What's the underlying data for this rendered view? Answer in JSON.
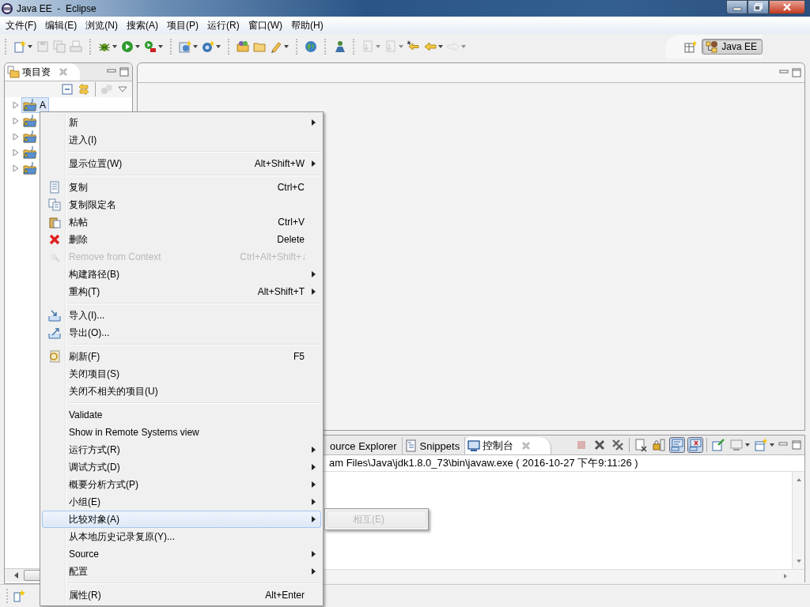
{
  "window": {
    "title": "Java EE  -  Eclipse"
  },
  "menu_bar": [
    "文件(F)",
    "编辑(E)",
    "浏览(N)",
    "搜索(A)",
    "项目(P)",
    "运行(R)",
    "窗口(W)",
    "帮助(H)"
  ],
  "toolbar": {
    "groups": [
      [
        {
          "disabled": false,
          "dropdown": true
        },
        {
          "disabled": true,
          "dropdown": false
        },
        {
          "disabled": true,
          "dropdown": false
        },
        {
          "disabled": true,
          "dropdown": false
        }
      ],
      [
        {
          "disabled": false,
          "dropdown": true
        },
        {
          "disabled": false,
          "dropdown": true
        },
        {
          "disabled": false,
          "dropdown": true
        }
      ],
      [
        {
          "disabled": false,
          "dropdown": true
        },
        {
          "disabled": false,
          "dropdown": true
        }
      ],
      [
        {
          "disabled": false,
          "dropdown": false
        },
        {
          "disabled": false,
          "dropdown": false
        },
        {
          "disabled": false,
          "dropdown": true
        }
      ],
      [
        {
          "disabled": false,
          "dropdown": false
        }
      ],
      [
        {
          "disabled": false,
          "dropdown": false
        }
      ],
      [
        {
          "disabled": true,
          "dropdown": true
        },
        {
          "disabled": true,
          "dropdown": true
        },
        {
          "disabled": false,
          "dropdown": false
        },
        {
          "disabled": false,
          "dropdown": true
        },
        {
          "disabled": true,
          "dropdown": true
        }
      ]
    ]
  },
  "perspective": {
    "label": "Java EE",
    "selected": true
  },
  "project_explorer": {
    "tab": {
      "label": "项目资"
    },
    "tree": [
      {
        "label": "A",
        "selected": true
      },
      {
        "selected": false
      },
      {
        "selected": false
      },
      {
        "selected": false
      },
      {
        "selected": false
      }
    ]
  },
  "console": {
    "tabs": [
      {
        "label": "ource Explorer",
        "selected": false
      },
      {
        "label": "Snippets",
        "selected": false
      },
      {
        "label": "控制台",
        "selected": true
      }
    ],
    "toolbar": [
      {
        "disabled": true,
        "pressed": false,
        "dropdown": false
      },
      {
        "disabled": false,
        "pressed": false,
        "dropdown": false
      },
      {
        "disabled": false,
        "pressed": false,
        "dropdown": false
      },
      {
        "disabled": false,
        "pressed": false,
        "dropdown": false
      },
      {
        "disabled": false,
        "pressed": false,
        "dropdown": false
      },
      {
        "disabled": false,
        "pressed": true,
        "dropdown": false
      },
      {
        "disabled": false,
        "pressed": true,
        "dropdown": false
      },
      {
        "disabled": false,
        "pressed": false,
        "dropdown": false
      },
      {
        "disabled": false,
        "pressed": false,
        "dropdown": true
      },
      {
        "disabled": false,
        "pressed": false,
        "dropdown": true
      }
    ],
    "info": "am Files\\Java\\jdk1.8.0_73\\bin\\javaw.exe ( 2016-10-27 下午9:11:26 )"
  },
  "context_menu": {
    "groups": [
      [
        {
          "label": "新",
          "submenu": true
        },
        {
          "label": "进入(I)"
        }
      ],
      [
        {
          "label": "显示位置(W)",
          "shortcut": "Alt+Shift+W",
          "submenu": true
        }
      ],
      [
        {
          "label": "复制",
          "shortcut": "Ctrl+C"
        },
        {
          "label": "复制限定名"
        },
        {
          "label": "粘帖",
          "shortcut": "Ctrl+V"
        },
        {
          "label": "删除",
          "shortcut": "Delete"
        },
        {
          "label": "Remove from Context",
          "shortcut": "Ctrl+Alt+Shift+↓",
          "disabled": true
        },
        {
          "label": "构建路径(B)",
          "submenu": true
        },
        {
          "label": "重构(T)",
          "shortcut": "Alt+Shift+T",
          "submenu": true
        }
      ],
      [
        {
          "label": "导入(I)..."
        },
        {
          "label": "导出(O)..."
        }
      ],
      [
        {
          "label": "刷新(F)",
          "shortcut": "F5"
        },
        {
          "label": "关闭项目(S)"
        },
        {
          "label": "关闭不相关的项目(U)"
        }
      ],
      [
        {
          "label": "Validate"
        },
        {
          "label": "Show in Remote Systems view"
        },
        {
          "label": "运行方式(R)",
          "submenu": true
        },
        {
          "label": "调试方式(D)",
          "submenu": true
        },
        {
          "label": "概要分析方式(P)",
          "submenu": true
        },
        {
          "label": "小组(E)",
          "submenu": true
        },
        {
          "label": "比较对象(A)",
          "submenu": true,
          "selected": true
        },
        {
          "label": "从本地历史记录复原(Y)..."
        },
        {
          "label": "Source",
          "submenu": true
        },
        {
          "label": "配置",
          "submenu": true
        }
      ],
      [
        {
          "label": "属性(R)",
          "shortcut": "Alt+Enter"
        }
      ]
    ]
  },
  "submenu": {
    "items": [
      {
        "label": "相互(E)",
        "disabled": true
      }
    ]
  }
}
